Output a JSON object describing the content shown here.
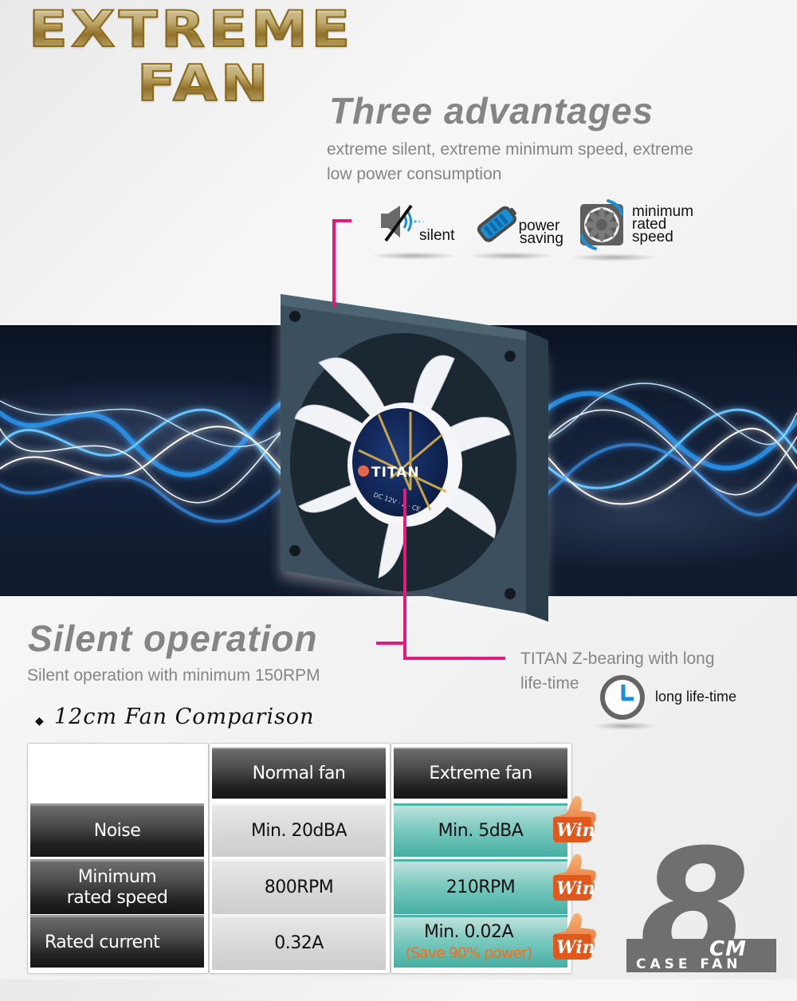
{
  "brand": {
    "line1": "EXTREME",
    "line2": "FAN"
  },
  "advantages": {
    "title": "Three advantages",
    "description_line1": "extreme silent, extreme minimum speed, extreme",
    "description_line2": "low power consumption",
    "features": [
      {
        "icon": "speaker-muted-icon",
        "label_lines": [
          "silent"
        ]
      },
      {
        "icon": "battery-icon",
        "label_lines": [
          "power",
          "saving"
        ]
      },
      {
        "icon": "fan-icon",
        "label_lines": [
          "minimum",
          "rated",
          "speed"
        ]
      }
    ]
  },
  "product": {
    "hub_brand": "TITAN",
    "hub_spec": "DC 12V · Z · CE"
  },
  "silent": {
    "title": "Silent operation",
    "subtitle": "Silent operation with minimum 150RPM"
  },
  "bearing": {
    "text_line1": "TITAN Z-bearing with long",
    "text_line2": "life-time",
    "icon": "clock-icon",
    "icon_label": "long life-time"
  },
  "comparison": {
    "heading": "12cm Fan Comparison",
    "columns": [
      "",
      "Normal fan",
      "Extreme fan"
    ],
    "rows": [
      {
        "label_lines": [
          "Noise"
        ],
        "normal": "Min. 20dBA",
        "extreme": "Min. 5dBA",
        "extreme_note": "",
        "badge": "Win"
      },
      {
        "label_lines": [
          "Minimum",
          "rated speed"
        ],
        "normal": "800RPM",
        "extreme": "210RPM",
        "extreme_note": "",
        "badge": "Win"
      },
      {
        "label_lines": [
          "Rated current"
        ],
        "normal": "0.32A",
        "extreme": "Min. 0.02A",
        "extreme_note": "(Save 90% power)",
        "badge": "Win"
      }
    ]
  },
  "size_badge": {
    "number": "8",
    "unit": "CM",
    "caption": "CASE FAN"
  },
  "colors": {
    "accent_pink": "#e8197a",
    "headline_gray": "#858585",
    "teal": "#45aea3",
    "win_orange": "#e0581c",
    "icon_blue": "#1b8fd6"
  }
}
